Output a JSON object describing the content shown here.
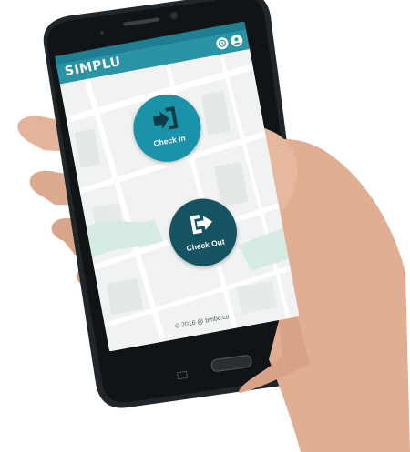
{
  "app": {
    "brand": "SIMPLU",
    "colors": {
      "appbar": "#2a93a6",
      "statusbar": "#1f7f92",
      "checkin": "#1a93a8",
      "checkout": "#165361"
    }
  },
  "actions": {
    "checkin": {
      "label": "Check In",
      "icon": "sign-in-icon"
    },
    "checkout": {
      "label": "Check Out",
      "icon": "sign-out-icon"
    }
  },
  "footer": {
    "copyright": "© 2016 @ bmbc.co"
  },
  "toolbar_icons": [
    "history-icon",
    "profile-icon"
  ]
}
